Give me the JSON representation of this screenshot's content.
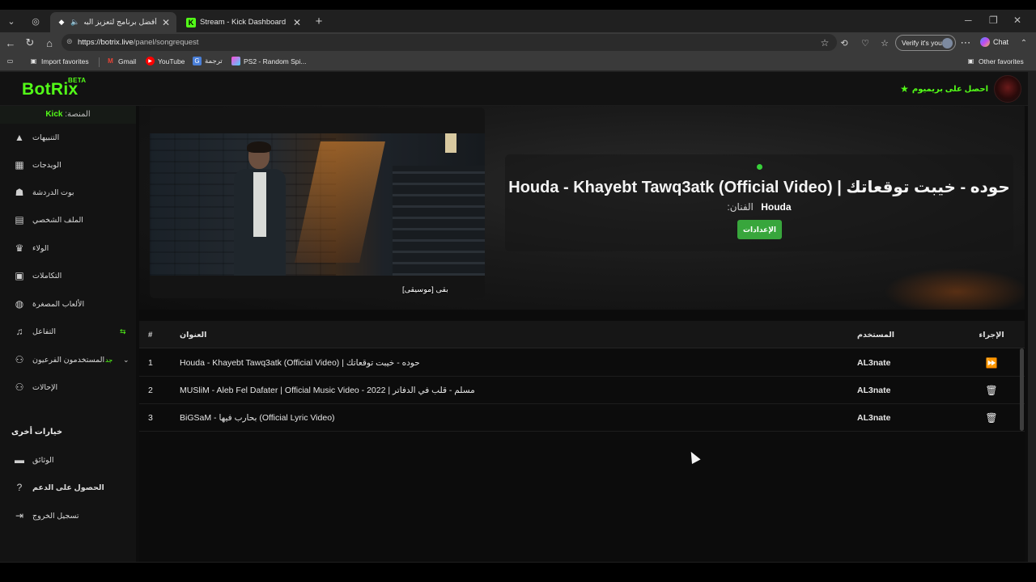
{
  "browser": {
    "tabs": [
      {
        "title": "أفضل برنامج لتعزيز البث المباشر",
        "favicon": "botrix-icon",
        "sound": true,
        "active": true
      },
      {
        "title": "Stream - Kick Dashboard",
        "favicon": "kick-icon",
        "active": false
      }
    ],
    "url_host": "https://botrix.live",
    "url_path": "/panel/songrequest",
    "verify_label": "Verify it's you",
    "chat_label": "Chat",
    "favorites": [
      {
        "label": "Import favorites",
        "icon": "folder-icon"
      },
      {
        "label": "Gmail",
        "icon": "gmail-icon"
      },
      {
        "label": "YouTube",
        "icon": "youtube-icon"
      },
      {
        "label": "ترجمة",
        "icon": "translate-icon"
      },
      {
        "label": "PS2 - Random Spi...",
        "icon": "ps2-icon"
      }
    ],
    "other_favorites": "Other favorites"
  },
  "app": {
    "logo": "BotRix",
    "beta": "BETA",
    "premium_label": "احصل على بريميوم",
    "platform_label": "المنصة:",
    "platform_value": "Kick",
    "sidebar": {
      "items": [
        {
          "label": "التنبيهات",
          "icon": "warning-icon"
        },
        {
          "label": "الويدجات",
          "icon": "widgets-icon"
        },
        {
          "label": "بوت الدردشة",
          "icon": "robot-icon"
        },
        {
          "label": "الملف الشخصي",
          "icon": "id-card-icon"
        },
        {
          "label": "الولاء",
          "icon": "trophy-icon"
        },
        {
          "label": "التكاملات",
          "icon": "integrations-icon"
        },
        {
          "label": "الألعاب المصغرة",
          "icon": "gamepad-icon"
        },
        {
          "label": "التفاعل",
          "icon": "music-icon",
          "badge": "⇆"
        },
        {
          "label": "المستخدمون الفرعيون",
          "icon": "users-icon",
          "badge": "جد"
        },
        {
          "label": "الإحالات",
          "icon": "referrals-icon"
        }
      ],
      "section_title": "خيارات أخرى",
      "other_items": [
        {
          "label": "الوثائق",
          "icon": "docs-icon"
        },
        {
          "label": "الحصول على الدعم",
          "icon": "help-icon"
        },
        {
          "label": "تسجيل الخروج",
          "icon": "logout-icon"
        }
      ]
    },
    "now_playing": {
      "title": "Houda - Khayebt Tawq3atk (Official Video) | حوده - خيبت توقعاتك",
      "artist_label": "الفنان:",
      "artist": "Houda",
      "settings_label": "الإعدادات",
      "video_caption": "بقى [موسيقى]"
    },
    "queue": {
      "headers": {
        "num": "#",
        "title": "العنوان",
        "user": "المستخدم",
        "action": "الإجراء"
      },
      "rows": [
        {
          "num": "1",
          "title": "Houda - Khayebt Tawq3atk (Official Video) | حوده - خيبت توقعاتك",
          "user": "AL3nate",
          "action": "skip-icon"
        },
        {
          "num": "2",
          "title": "MUSliM - Aleb Fel Dafater | Official Music Video - 2022 | مسلم - قلب في الدفاتر",
          "user": "AL3nate",
          "action": "trash-icon"
        },
        {
          "num": "3",
          "title": "BiGSaM - بحارب فيها (Official Lyric Video)",
          "user": "AL3nate",
          "action": "trash-icon"
        }
      ]
    }
  },
  "colors": {
    "brand": "#53fc18",
    "button": "#38a63c",
    "background": "#0d0d0d"
  }
}
